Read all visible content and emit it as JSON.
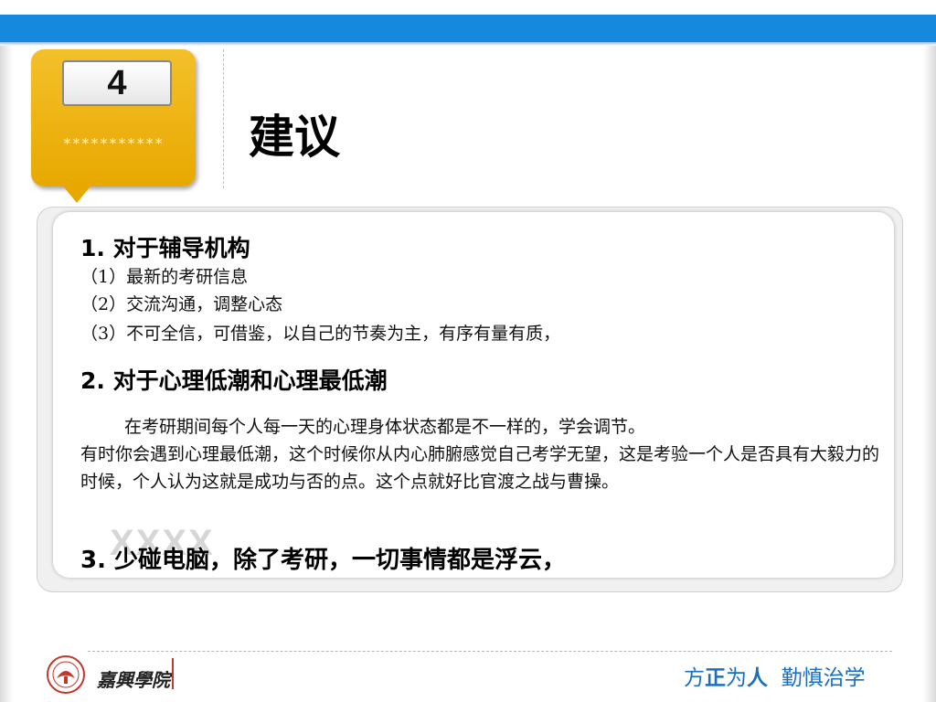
{
  "badge": {
    "number": "4",
    "stars": "***********"
  },
  "title": "建议",
  "sections": [
    {
      "heading": "1. 对于辅导机构",
      "items": [
        "（1）最新的考研信息",
        "（2）交流沟通，调整心态",
        "（3）不可全信，可借鉴，以自己的节奏为主，有序有量有质，"
      ]
    },
    {
      "heading": "2. 对于心理低潮和心理最低潮",
      "paragraph_line1": "在考研期间每个人每一天的心理身体状态都是不一样的，学会调节。",
      "paragraph_rest": "有时你会遇到心理最低潮，这个时候你从内心肺腑感觉自己考学无望，这是考验一个人是否具有大毅力的时候，个人认为这就是成功与否的点。这个点就好比官渡之战与曹操。"
    },
    {
      "heading": "3. 少碰电脑，除了考研，一切事情都是浮云，"
    }
  ],
  "watermark": "XXXX",
  "footer": {
    "school_name": "嘉興學院",
    "motto_part1": "方",
    "motto_part2": "正",
    "motto_part3": "为",
    "motto_part4": "人",
    "motto_part5": "勤慎治学"
  },
  "colors": {
    "top_bar": "#1688dd",
    "badge": "#e8a800",
    "motto": "#1a6fc0"
  }
}
